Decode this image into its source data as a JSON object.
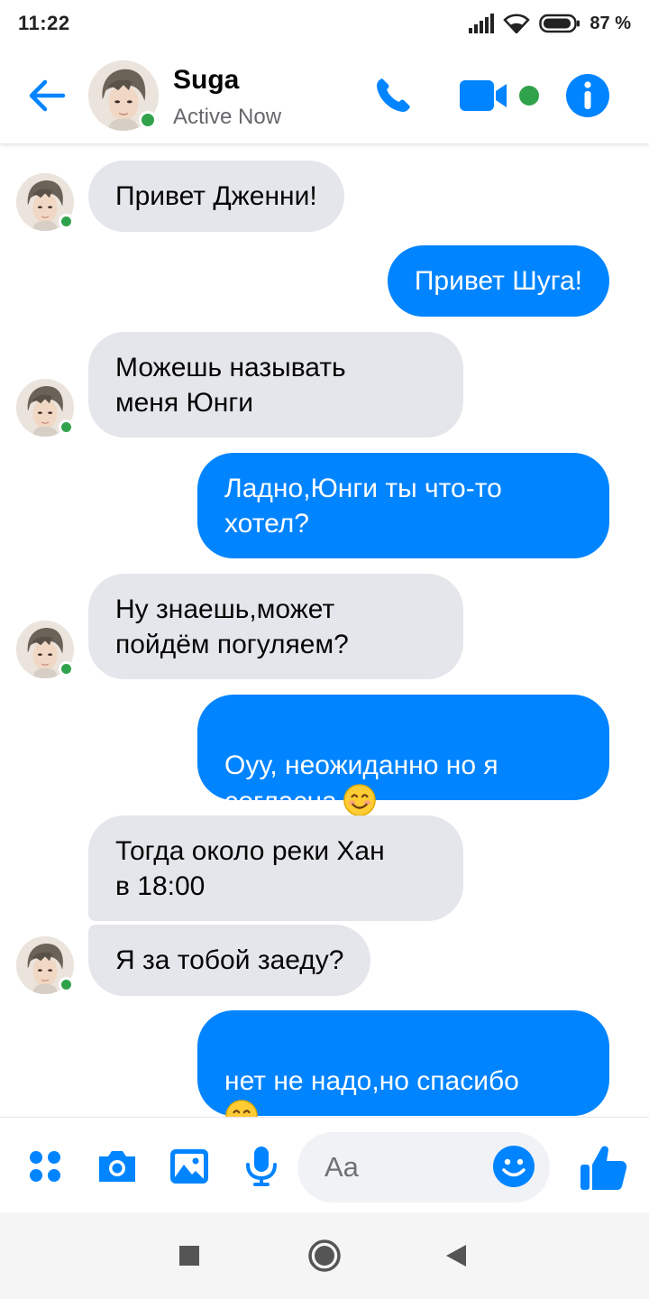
{
  "status_bar": {
    "time": "11:22",
    "battery": "87 %",
    "icons": [
      "signal-icon",
      "wifi-icon",
      "battery-icon"
    ]
  },
  "header": {
    "contact_name": "Suga",
    "contact_status": "Active Now",
    "icons": [
      "back-arrow-icon",
      "phone-icon",
      "video-camera-icon",
      "info-icon"
    ]
  },
  "messages": [
    {
      "side": "in",
      "text": "Привет Дженни!"
    },
    {
      "side": "out",
      "text": "Привет Шуга!"
    },
    {
      "side": "in",
      "text": "Можешь называть\nменя Юнги"
    },
    {
      "side": "out",
      "text": "Ладно,Юнги ты что-то\nхотел?"
    },
    {
      "side": "in",
      "text": "Ну знаешь,может\nпойдём погуляем?"
    },
    {
      "side": "out",
      "text": "Оуу, неожиданно но я\nсогласна",
      "emoji": "smiling-face-emoji"
    },
    {
      "side": "in",
      "text": "Тогда около реки Хан\nв 18:00"
    },
    {
      "side": "in",
      "text": "Я за тобой заеду?"
    },
    {
      "side": "out",
      "text": "нет не надо,но спасибо\n",
      "emoji": "smiling-face-emoji"
    }
  ],
  "composer": {
    "placeholder": "Aa",
    "icons": [
      "more-apps-icon",
      "camera-icon",
      "image-icon",
      "microphone-icon",
      "emoji-icon",
      "thumbs-up-icon"
    ]
  },
  "colors": {
    "accent": "#0084ff",
    "incoming_bubble": "#e4e6eb",
    "online": "#31a24c"
  },
  "navbar": {
    "icons": [
      "square-icon",
      "home-circle-icon",
      "back-triangle-icon"
    ]
  }
}
